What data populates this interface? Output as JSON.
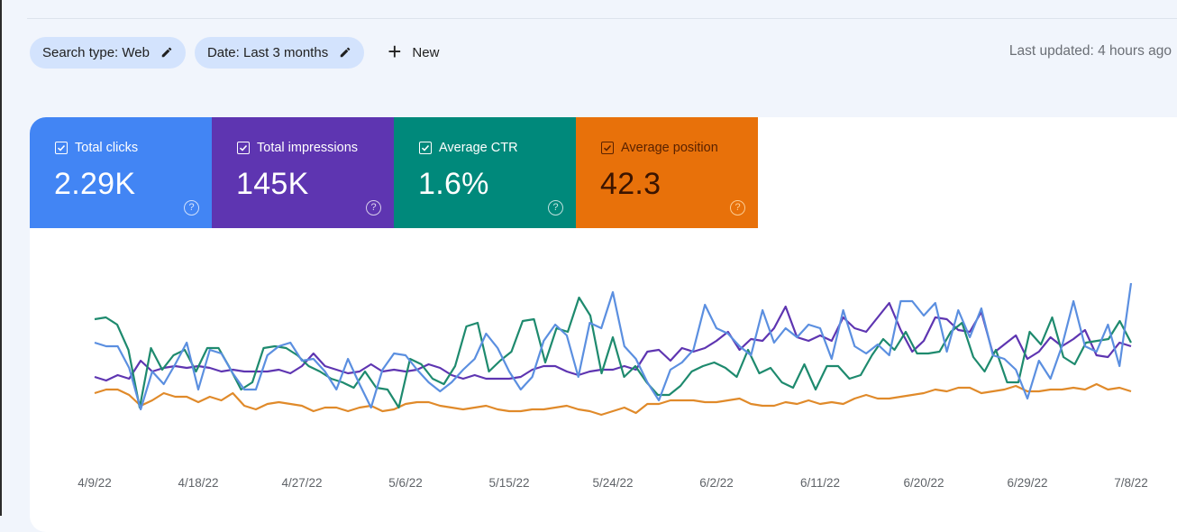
{
  "filters": {
    "chips": [
      {
        "label": "Search type: Web",
        "icon": "pencil-icon"
      },
      {
        "label": "Date: Last 3 months",
        "icon": "pencil-icon"
      }
    ],
    "new_label": "New",
    "new_icon": "plus-icon"
  },
  "last_updated": "Last updated: 4 hours ago",
  "metrics": [
    {
      "label": "Total clicks",
      "value": "2.29K",
      "checked": true,
      "color": "#4285f4"
    },
    {
      "label": "Total impressions",
      "value": "145K",
      "checked": true,
      "color": "#5e35b1"
    },
    {
      "label": "Average CTR",
      "value": "1.6%",
      "checked": true,
      "color": "#00897b"
    },
    {
      "label": "Average position",
      "value": "42.3",
      "checked": true,
      "color": "#e8710a"
    }
  ],
  "chart_data": {
    "type": "line",
    "title": "",
    "xlabel": "",
    "ylabel": "",
    "ylim": [
      0,
      100
    ],
    "y_units": "normalized (each series scaled independently; no y-axis shown)",
    "grid": false,
    "legend": "metric cards (top-left)",
    "x_tick_labels": [
      "4/9/22",
      "4/18/22",
      "4/27/22",
      "5/6/22",
      "5/15/22",
      "5/24/22",
      "6/2/22",
      "6/11/22",
      "6/20/22",
      "6/29/22",
      "7/8/22"
    ],
    "x_start": "4/9/22",
    "x_end": "7/8/22",
    "series": [
      {
        "name": "Total clicks",
        "color": "#5b8fe0",
        "values": [
          60,
          58,
          58,
          46,
          23,
          44,
          37,
          48,
          60,
          34,
          56,
          54,
          43,
          34,
          34,
          53,
          58,
          60,
          50,
          51,
          44,
          34,
          51,
          37,
          24,
          45,
          54,
          53,
          45,
          38,
          33,
          38,
          45,
          51,
          65,
          57,
          44,
          34,
          41,
          61,
          70,
          64,
          41,
          71,
          68,
          88,
          58,
          51,
          38,
          28,
          45,
          49,
          56,
          81,
          68,
          65,
          58,
          53,
          78,
          60,
          68,
          63,
          70,
          68,
          51,
          78,
          58,
          54,
          59,
          53,
          83,
          83,
          75,
          82,
          55,
          78,
          63,
          79,
          53,
          51,
          45,
          29,
          50,
          40,
          58,
          83,
          58,
          55,
          70,
          47,
          93
        ]
      },
      {
        "name": "Total impressions",
        "color": "#5e35b1",
        "values": [
          41,
          39,
          42,
          40,
          50,
          44,
          46,
          47,
          46,
          47,
          46,
          44,
          45,
          44,
          44,
          44,
          45,
          43,
          47,
          54,
          47,
          45,
          43,
          44,
          48,
          44,
          45,
          44,
          45,
          48,
          46,
          42,
          40,
          42,
          40,
          40,
          40,
          41,
          45,
          47,
          47,
          44,
          42,
          44,
          45,
          45,
          47,
          45,
          55,
          56,
          50,
          57,
          55,
          57,
          61,
          66,
          56,
          62,
          61,
          68,
          80,
          63,
          61,
          64,
          61,
          74,
          68,
          66,
          74,
          82,
          67,
          55,
          61,
          74,
          73,
          67,
          66,
          77,
          54,
          59,
          64,
          51,
          55,
          63,
          58,
          62,
          67,
          53,
          52,
          60,
          58
        ]
      },
      {
        "name": "Average CTR",
        "color": "#1e8a6e",
        "values": [
          73,
          74,
          70,
          56,
          24,
          57,
          45,
          53,
          56,
          44,
          57,
          57,
          46,
          34,
          38,
          57,
          58,
          57,
          53,
          47,
          44,
          40,
          38,
          35,
          44,
          35,
          34,
          24,
          51,
          48,
          40,
          37,
          47,
          69,
          71,
          44,
          50,
          55,
          72,
          73,
          49,
          68,
          66,
          85,
          75,
          43,
          63,
          41,
          47,
          38,
          31,
          31,
          36,
          44,
          47,
          49,
          46,
          41,
          56,
          43,
          46,
          38,
          35,
          48,
          34,
          47,
          47,
          40,
          42,
          53,
          62,
          56,
          66,
          54,
          54,
          55,
          66,
          71,
          52,
          44,
          56,
          38,
          38,
          66,
          59,
          74,
          52,
          48,
          60,
          61,
          62,
          72,
          60
        ]
      },
      {
        "name": "Average position",
        "color": "#e08a2a",
        "values": [
          32,
          34,
          34,
          31,
          25,
          28,
          32,
          30,
          30,
          27,
          30,
          28,
          32,
          25,
          23,
          26,
          27,
          26,
          25,
          22,
          24,
          24,
          22,
          24,
          25,
          22,
          23,
          26,
          27,
          27,
          25,
          24,
          23,
          24,
          25,
          23,
          22,
          22,
          23,
          23,
          24,
          25,
          23,
          22,
          20,
          22,
          24,
          21,
          26,
          26,
          28,
          28,
          28,
          27,
          27,
          28,
          29,
          26,
          25,
          25,
          27,
          26,
          28,
          26,
          27,
          26,
          29,
          31,
          29,
          29,
          30,
          31,
          32,
          34,
          33,
          35,
          35,
          32,
          33,
          34,
          36,
          33,
          33,
          34,
          34,
          35,
          34,
          37,
          34,
          35,
          33
        ]
      }
    ]
  }
}
